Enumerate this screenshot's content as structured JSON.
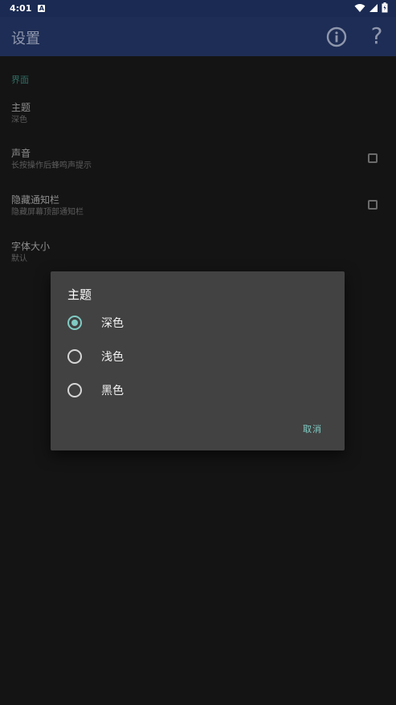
{
  "status_bar": {
    "time": "4:01",
    "notification_icon": "A"
  },
  "app_bar": {
    "title": "设置",
    "actions": [
      "info-icon",
      "help-icon"
    ],
    "help_glyph": "?"
  },
  "settings": {
    "section_header": "界面",
    "items": [
      {
        "title": "主题",
        "summary": "深色",
        "has_checkbox": false
      },
      {
        "title": "声音",
        "summary": "长按操作后蜂鸣声提示",
        "has_checkbox": true,
        "checked": false
      },
      {
        "title": "隐藏通知栏",
        "summary": "隐藏屏幕顶部通知栏",
        "has_checkbox": true,
        "checked": false
      },
      {
        "title": "字体大小",
        "summary": "默认",
        "has_checkbox": false
      }
    ]
  },
  "dialog": {
    "title": "主题",
    "options": [
      {
        "label": "深色",
        "selected": true
      },
      {
        "label": "浅色",
        "selected": false
      },
      {
        "label": "黑色",
        "selected": false
      }
    ],
    "cancel_label": "取消"
  },
  "colors": {
    "accent": "#80cbc4",
    "app_bar": "#1e2d55",
    "dialog_bg": "#424242",
    "background": "#141414"
  }
}
